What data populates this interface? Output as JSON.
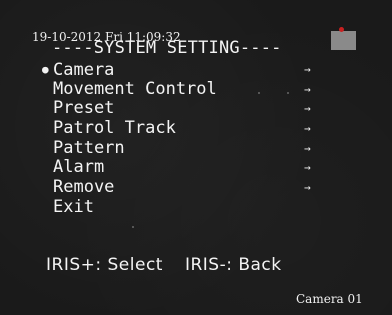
{
  "osd": {
    "datetime": "19-10-2012 Fri 11:09:32",
    "title": "----SYSTEM SETTING----",
    "menu": [
      {
        "label": "Camera",
        "arrow": "→",
        "selected": true
      },
      {
        "label": "Movement Control",
        "arrow": "→",
        "selected": false
      },
      {
        "label": "Preset",
        "arrow": "→",
        "selected": false
      },
      {
        "label": "Patrol Track",
        "arrow": "→",
        "selected": false
      },
      {
        "label": "Pattern",
        "arrow": "→",
        "selected": false
      },
      {
        "label": "Alarm",
        "arrow": "→",
        "selected": false
      },
      {
        "label": "Remove",
        "arrow": "→",
        "selected": false
      },
      {
        "label": "Exit",
        "arrow": "",
        "selected": false
      }
    ],
    "cursor_glyph": "●",
    "help_select": "IRIS+: Select",
    "help_back": "IRIS-: Back",
    "camera_label": "Camera 01"
  },
  "colors": {
    "background": "#1a1a1a",
    "text": "#f4f4f4",
    "rec_box": "#8a8a8a",
    "rec_dot": "#c82020"
  }
}
